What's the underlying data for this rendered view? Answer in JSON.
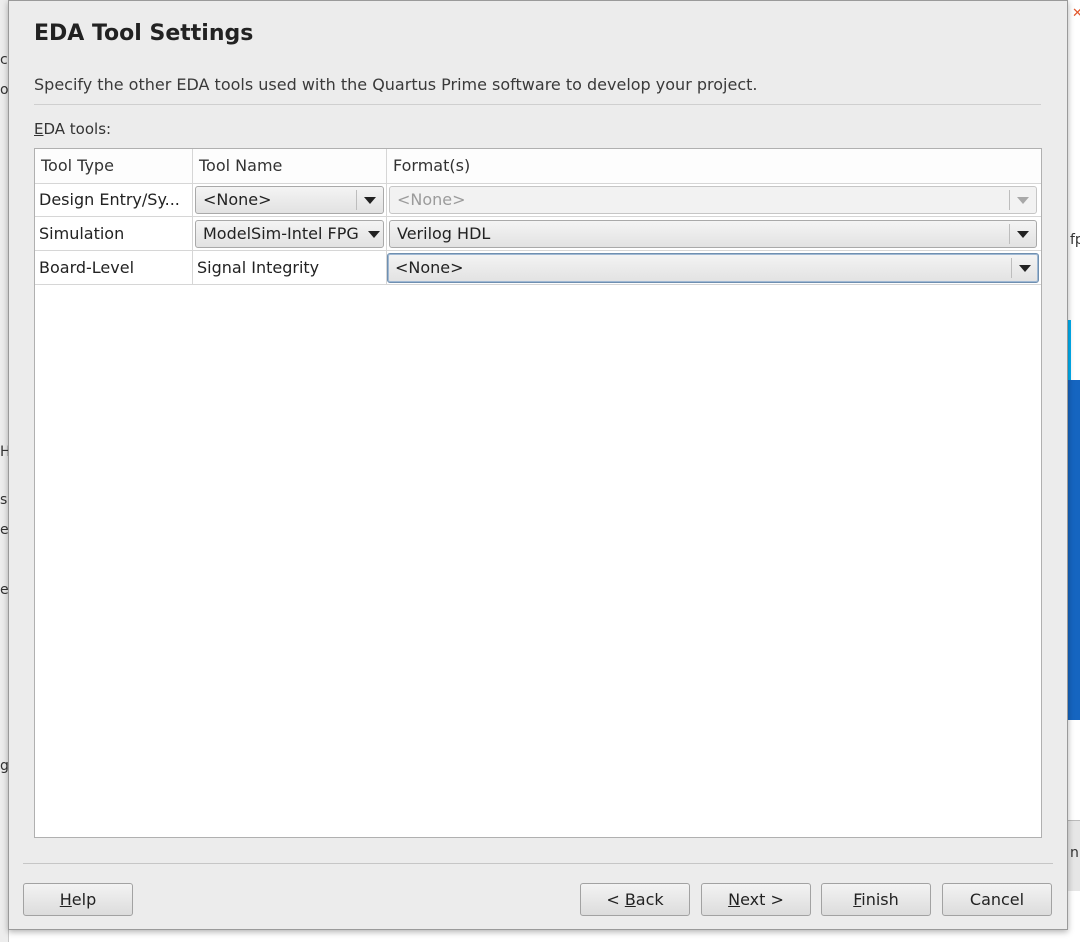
{
  "dialog": {
    "title": "EDA Tool Settings",
    "subtitle": "Specify the other EDA tools used with the Quartus Prime software to develop your project.",
    "tools_label_mnemonic": "E",
    "tools_label_rest": "DA tools:"
  },
  "table": {
    "headers": [
      "Tool Type",
      "Tool Name",
      "Format(s)"
    ],
    "rows": [
      {
        "tool_type": "Design Entry/Sy...",
        "tool_name": "<None>",
        "format": "<None>"
      },
      {
        "tool_type": "Simulation",
        "tool_name": "ModelSim-Intel FPGA",
        "format": "Verilog HDL"
      },
      {
        "tool_type": "Board-Level",
        "tool_name": "Signal Integrity",
        "format": "<None>"
      }
    ]
  },
  "buttons": {
    "help_mn": "H",
    "help_rest": "elp",
    "back_pre": "< ",
    "back_mn": "B",
    "back_rest": "ack",
    "next_mn": "N",
    "next_rest": "ext >",
    "finish_mn": "F",
    "finish_rest": "inish",
    "cancel": "Cancel"
  },
  "background": {
    "left_fragments": [
      "c",
      "o",
      "H",
      "s",
      "e",
      "e",
      "g"
    ],
    "right_fragments": [
      "fp",
      "n"
    ]
  },
  "colors": {
    "dialog_bg": "#ececec",
    "focus_border": "#6f8fb0",
    "bg_app_blue": "#1565c0",
    "bg_app_accent": "#00aeef"
  }
}
